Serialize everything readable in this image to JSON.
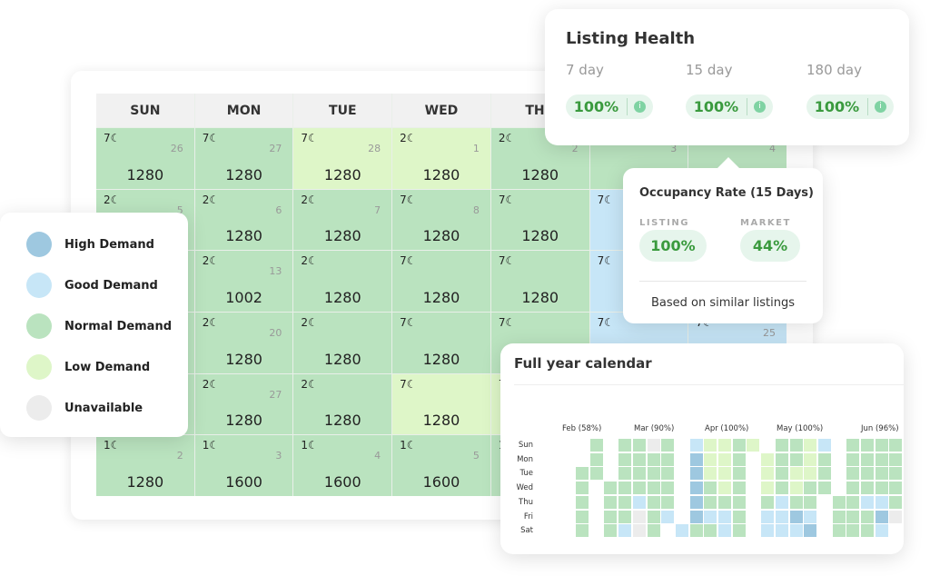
{
  "colors": {
    "high": "#9ec8e0",
    "good": "#c7e6f7",
    "normal": "#bae3bf",
    "low": "#def6c8",
    "unavailable": "#ececec",
    "accent_green": "#3a9a3e"
  },
  "calendar": {
    "weekdays": [
      "SUN",
      "MON",
      "TUE",
      "WED",
      "THU",
      "FRI",
      "SAT"
    ],
    "weeks": [
      [
        {
          "min": "7",
          "date": "26",
          "price": "1280",
          "d": "normal"
        },
        {
          "min": "7",
          "date": "27",
          "price": "1280",
          "d": "normal"
        },
        {
          "min": "7",
          "date": "28",
          "price": "1280",
          "d": "low"
        },
        {
          "min": "2",
          "date": "1",
          "price": "1280",
          "d": "low"
        },
        {
          "min": "2",
          "date": "2",
          "price": "1280",
          "d": "normal"
        },
        {
          "min": "",
          "date": "3",
          "price": "",
          "d": "normal"
        },
        {
          "min": "",
          "date": "4",
          "price": "",
          "d": "normal"
        }
      ],
      [
        {
          "min": "2",
          "date": "5",
          "price": "",
          "d": "normal"
        },
        {
          "min": "2",
          "date": "6",
          "price": "1280",
          "d": "normal"
        },
        {
          "min": "2",
          "date": "7",
          "price": "1280",
          "d": "normal"
        },
        {
          "min": "7",
          "date": "8",
          "price": "1280",
          "d": "normal"
        },
        {
          "min": "7",
          "date": "",
          "price": "1280",
          "d": "normal"
        },
        {
          "min": "7",
          "date": "",
          "price": "",
          "d": "good"
        },
        {
          "min": "",
          "date": "",
          "price": "",
          "d": "good"
        }
      ],
      [
        {
          "min": "",
          "date": "",
          "price": "",
          "d": "normal"
        },
        {
          "min": "2",
          "date": "13",
          "price": "1002",
          "d": "normal"
        },
        {
          "min": "2",
          "date": "",
          "price": "1280",
          "d": "normal"
        },
        {
          "min": "7",
          "date": "",
          "price": "1280",
          "d": "normal"
        },
        {
          "min": "7",
          "date": "",
          "price": "1280",
          "d": "normal"
        },
        {
          "min": "7",
          "date": "",
          "price": "",
          "d": "good"
        },
        {
          "min": "",
          "date": "",
          "price": "",
          "d": "good"
        }
      ],
      [
        {
          "min": "",
          "date": "",
          "price": "",
          "d": "normal"
        },
        {
          "min": "2",
          "date": "20",
          "price": "1280",
          "d": "normal"
        },
        {
          "min": "2",
          "date": "",
          "price": "1280",
          "d": "normal"
        },
        {
          "min": "7",
          "date": "",
          "price": "1280",
          "d": "normal"
        },
        {
          "min": "7",
          "date": "",
          "price": "",
          "d": "normal"
        },
        {
          "min": "7",
          "date": "",
          "price": "",
          "d": "good"
        },
        {
          "min": "7",
          "date": "25",
          "price": "",
          "d": "good"
        }
      ],
      [
        {
          "min": "",
          "date": "",
          "price": "",
          "d": "normal"
        },
        {
          "min": "2",
          "date": "27",
          "price": "1280",
          "d": "normal"
        },
        {
          "min": "2",
          "date": "",
          "price": "1280",
          "d": "normal"
        },
        {
          "min": "7",
          "date": "",
          "price": "1280",
          "d": "low"
        },
        {
          "min": "7",
          "date": "",
          "price": "",
          "d": "low"
        },
        {
          "min": "",
          "date": "",
          "price": "",
          "d": "normal"
        },
        {
          "min": "",
          "date": "",
          "price": "",
          "d": "normal"
        }
      ],
      [
        {
          "min": "1",
          "date": "2",
          "price": "1280",
          "d": "normal"
        },
        {
          "min": "1",
          "date": "3",
          "price": "1600",
          "d": "normal"
        },
        {
          "min": "1",
          "date": "4",
          "price": "1600",
          "d": "normal"
        },
        {
          "min": "1",
          "date": "5",
          "price": "1600",
          "d": "normal"
        },
        {
          "min": "1",
          "date": "",
          "price": "",
          "d": "normal"
        },
        {
          "min": "",
          "date": "",
          "price": "",
          "d": "normal"
        },
        {
          "min": "",
          "date": "",
          "price": "",
          "d": "normal"
        }
      ]
    ]
  },
  "legend": [
    {
      "label": "High Demand",
      "key": "high"
    },
    {
      "label": "Good Demand",
      "key": "good"
    },
    {
      "label": "Normal Demand",
      "key": "normal"
    },
    {
      "label": "Low Demand",
      "key": "low"
    },
    {
      "label": "Unavailable",
      "key": "unavailable"
    }
  ],
  "listing_health": {
    "title": "Listing Health",
    "periods": [
      {
        "label": "7 day",
        "value": "100%"
      },
      {
        "label": "15 day",
        "value": "100%"
      },
      {
        "label": "180 day",
        "value": "100%"
      }
    ],
    "info_icon": "info-icon"
  },
  "occupancy": {
    "title": "Occupancy Rate (15 Days)",
    "listing_label": "LISTING",
    "listing_value": "100%",
    "market_label": "MARKET",
    "market_value": "44%",
    "footer": "Based on similar listings"
  },
  "full_year": {
    "title": "Full year calendar",
    "months": [
      "Feb (58%)",
      "Mar (90%)",
      "Apr (100%)",
      "May (100%)",
      "Jun (96%)"
    ],
    "days": [
      "Sun",
      "Mon",
      "Tue",
      "Wed",
      "Thu",
      "Fri",
      "Sat"
    ],
    "legend_codes": {
      "h": "high",
      "g": "good",
      "n": "normal",
      "l": "low",
      "u": "unavailable",
      "_": "empty"
    },
    "rows": [
      "_n_nnun_gllnl_nnlg_nnnn",
      "_n_nnnn_hlln_lnnln_nnnn",
      "nn_nnnn_hlln_lnlln_nnnn",
      "n_nnnnn_hnln_lnlnn_nnnn",
      "n_nngnn_hnnn_ngnn_nnggn",
      "n_nnung_hggn_gghg_nnnhu",
      "n_ngun_gnngn_gggh_nnng_"
    ]
  }
}
